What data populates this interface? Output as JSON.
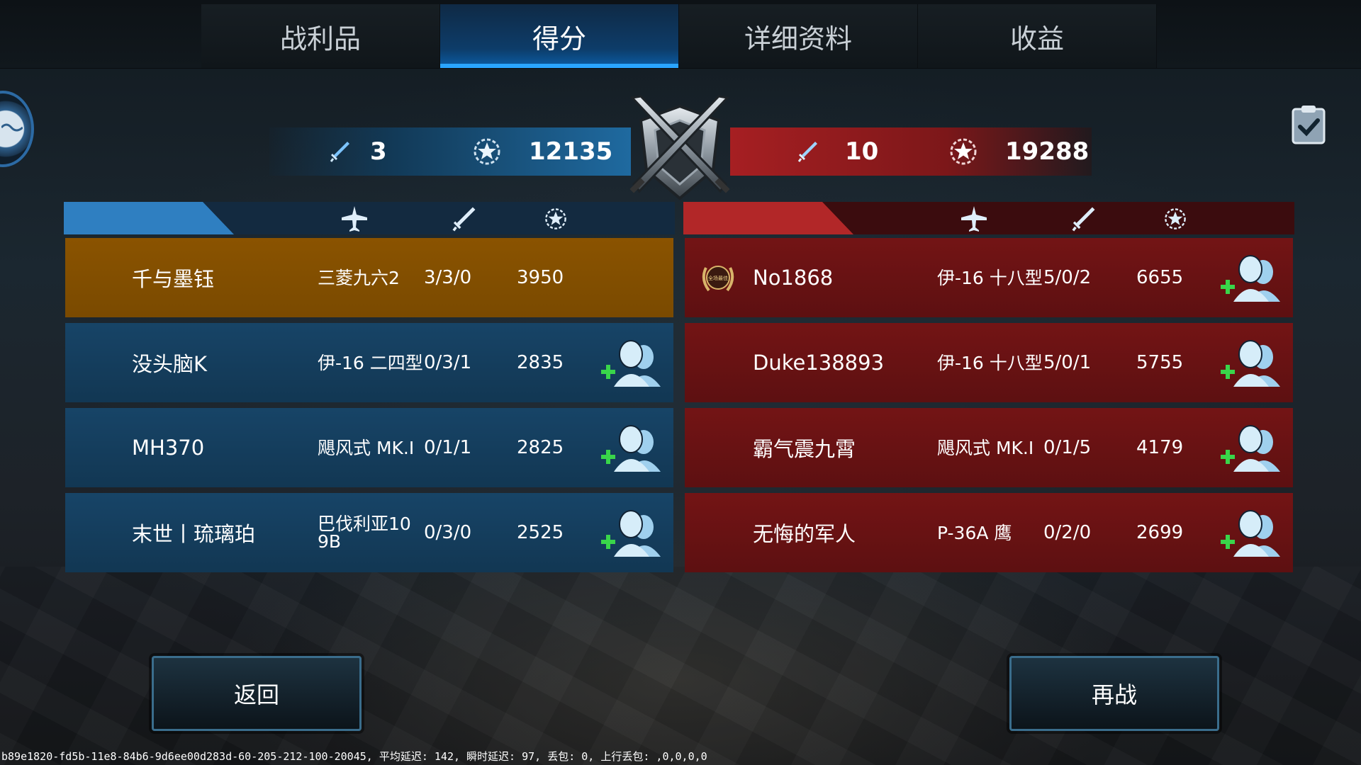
{
  "tabs": [
    {
      "label": "战利品"
    },
    {
      "label": "得分"
    },
    {
      "label": "详细资料"
    },
    {
      "label": "收益"
    }
  ],
  "active_tab": "得分",
  "summary": {
    "blue": {
      "kills": "3",
      "score": "12135"
    },
    "red": {
      "kills": "10",
      "score": "19288"
    }
  },
  "blue_team": [
    {
      "name": "千与墨钰",
      "plane": "三菱九六2",
      "kda": "3/3/0",
      "score": "3950"
    },
    {
      "name": "没头脑K",
      "plane": "伊-16 二四型",
      "kda": "0/3/1",
      "score": "2835"
    },
    {
      "name": "MH370",
      "plane": "飓风式 MK.I",
      "kda": "0/1/1",
      "score": "2825"
    },
    {
      "name": "末世丨琉璃珀",
      "plane": "巴伐利亚10 9B",
      "kda": "0/3/0",
      "score": "2525"
    }
  ],
  "red_team": [
    {
      "name": "No1868",
      "plane": "伊-16 十八型",
      "kda": "5/0/2",
      "score": "6655",
      "mvp_text": "全场最佳"
    },
    {
      "name": "Duke138893",
      "plane": "伊-16 十八型",
      "kda": "5/0/1",
      "score": "5755"
    },
    {
      "name": "霸气震九霄",
      "plane": "飓风式 MK.I",
      "kda": "0/1/5",
      "score": "4179"
    },
    {
      "name": "无悔的军人",
      "plane": "P-36A 鹰",
      "kda": "0/2/0",
      "score": "2699"
    }
  ],
  "buttons": {
    "back": "返回",
    "rematch": "再战"
  },
  "debug_line": "b89e1820-fd5b-11e8-84b6-9d6ee00d283d-60-205-212-100-20045, 平均延迟: 142, 瞬时延迟: 97, 丢包: 0, 上行丢包: ,0,0,0,0",
  "colors": {
    "blue_team": "#2f7fc1",
    "red_team": "#b22728",
    "self_row": "#8a5300"
  },
  "icons": [
    "plane-icon",
    "sword-icon",
    "star-wreath-icon",
    "add-friend-icon",
    "clipboard-check-icon",
    "crossed-swords-emblem-icon",
    "mvp-laurel-icon"
  ]
}
